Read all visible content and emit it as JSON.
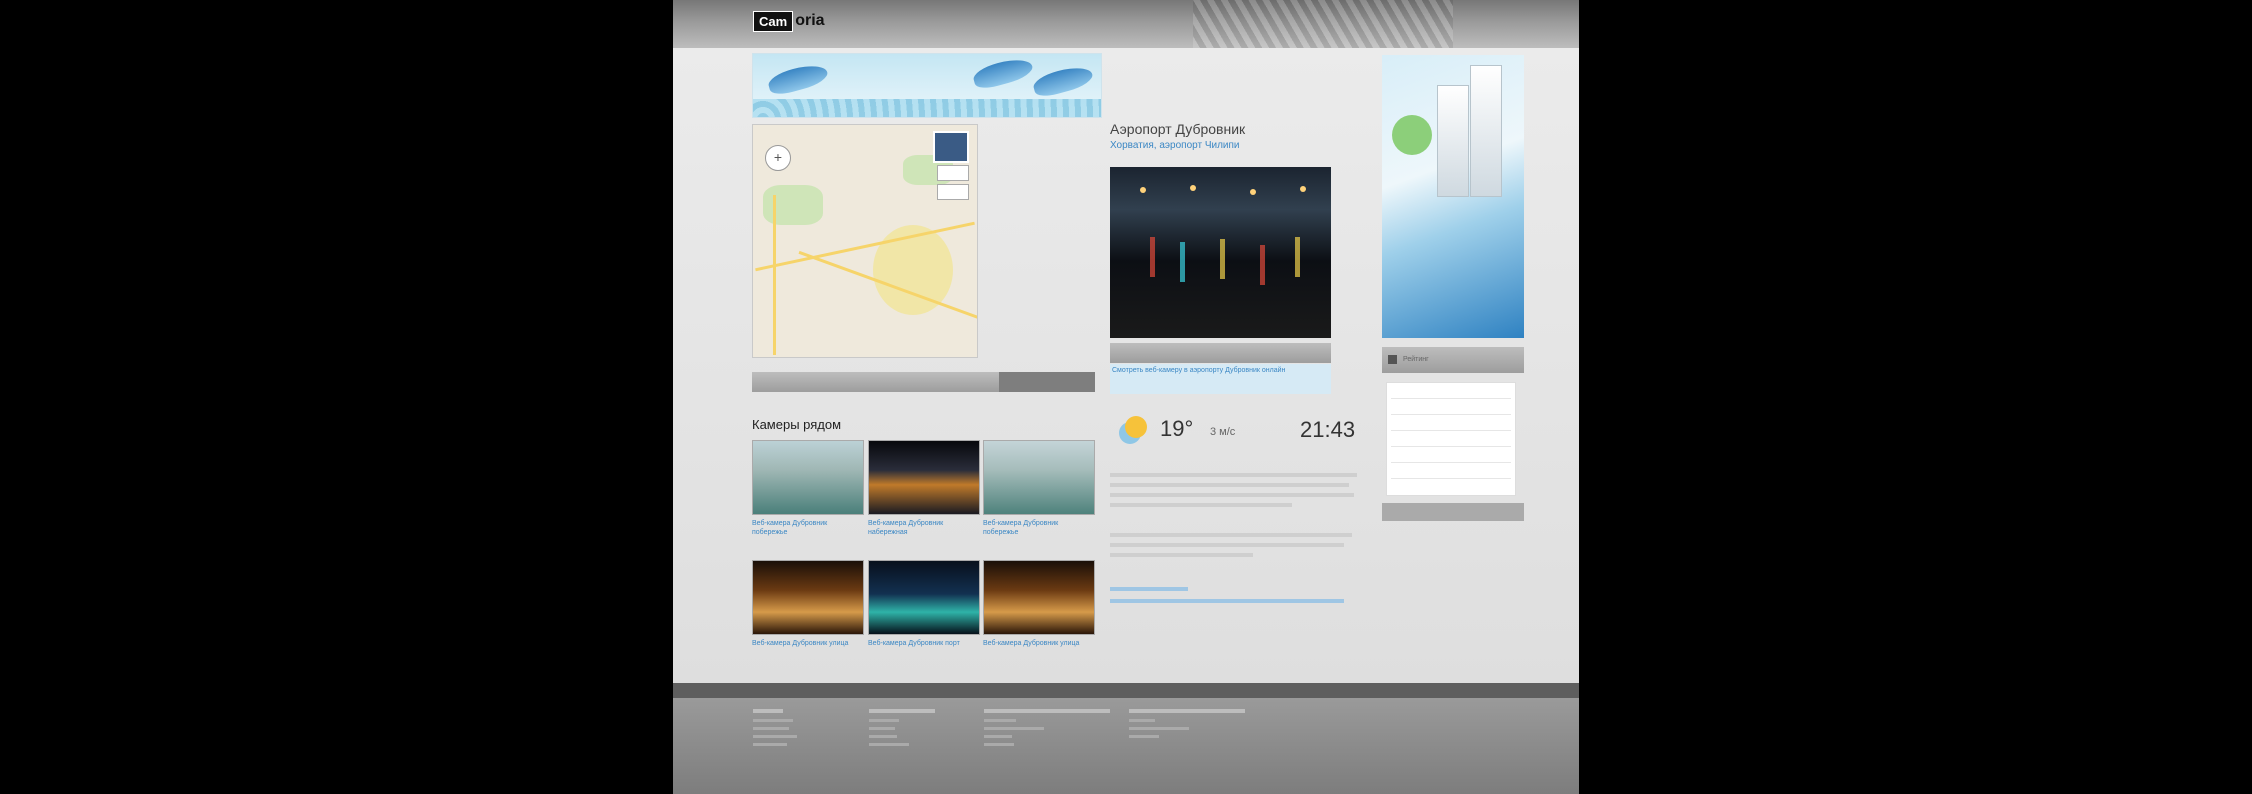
{
  "colors": {
    "accent": "#3b87c4",
    "header": "#8a8a8a",
    "footer": "#808080",
    "caption_bg": "#d6eaf5"
  },
  "icons": [
    "zoom-control-icon",
    "satellite-thumb-icon",
    "weather-sun-icon",
    "side-square-icon"
  ],
  "header": {
    "logo_box": "Cam",
    "logo_rest": "oria"
  },
  "airport": {
    "title": "Аэропорт Дубровник",
    "subtitle": "Хорватия, аэропорт Чилипи"
  },
  "photo": {
    "caption": "Смотреть веб-камеру в аэропорту Дубровник онлайн"
  },
  "webcams": {
    "title": "Камеры рядом",
    "items": [
      {
        "caption": "Веб-камера Дубровник побережье"
      },
      {
        "caption": "Веб-камера Дубровник набережная"
      },
      {
        "caption": "Веб-камера Дубровник побережье"
      },
      {
        "caption": "Веб-камера Дубровник улица"
      },
      {
        "caption": "Веб-камера Дубровник порт"
      },
      {
        "caption": "Веб-камера Дубровник улица"
      }
    ]
  },
  "weather": {
    "temp": "19°",
    "wind": "3 м/с",
    "time": "21:43"
  },
  "side": {
    "bar_label": "Рейтинг"
  }
}
